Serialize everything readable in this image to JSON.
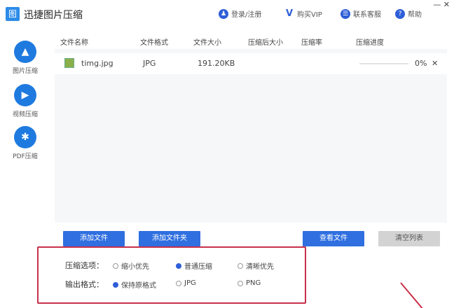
{
  "app": {
    "logo": "图",
    "title": "迅捷图片压缩"
  },
  "topnav": [
    {
      "icon": "user-icon",
      "glyph": "♟",
      "label": "登录/注册"
    },
    {
      "icon": "vip-icon",
      "glyph": "V",
      "label": "购买VIP"
    },
    {
      "icon": "service-icon",
      "glyph": "☰",
      "label": "联系客服"
    },
    {
      "icon": "help-icon",
      "glyph": "?",
      "label": "帮助"
    }
  ],
  "window": {
    "minimize": "—",
    "close": "✕"
  },
  "sidebar": [
    {
      "icon": "image-icon",
      "glyph": "▲",
      "label": "图片压缩"
    },
    {
      "icon": "play-icon",
      "glyph": "▶",
      "label": "视频压缩"
    },
    {
      "icon": "pdf-icon",
      "glyph": "✱",
      "label": "PDF压缩"
    }
  ],
  "table": {
    "headers": [
      "文件名称",
      "文件格式",
      "文件大小",
      "压缩后大小",
      "压缩率",
      "压缩进度"
    ],
    "rows": [
      {
        "name": "timg.jpg",
        "format": "JPG",
        "size": "191.20KB",
        "compressed": "",
        "ratio": "",
        "progress": "0%",
        "progress_value": 0,
        "remove": "✕"
      }
    ]
  },
  "buttons": {
    "add_file": "添加文件",
    "add_folder": "添加文件夹",
    "view_file": "查看文件",
    "clear_list": "清空列表"
  },
  "options": {
    "compress_label": "压缩选项：",
    "compress": [
      "缩小优先",
      "普通压缩",
      "清晰优先"
    ],
    "compress_selected": 1,
    "format_label": "输出格式：",
    "format": [
      "保持原格式",
      "JPG",
      "PNG"
    ],
    "format_selected": 0
  },
  "colors": {
    "accent": "#2f6fe0",
    "highlight": "#c8304a"
  }
}
